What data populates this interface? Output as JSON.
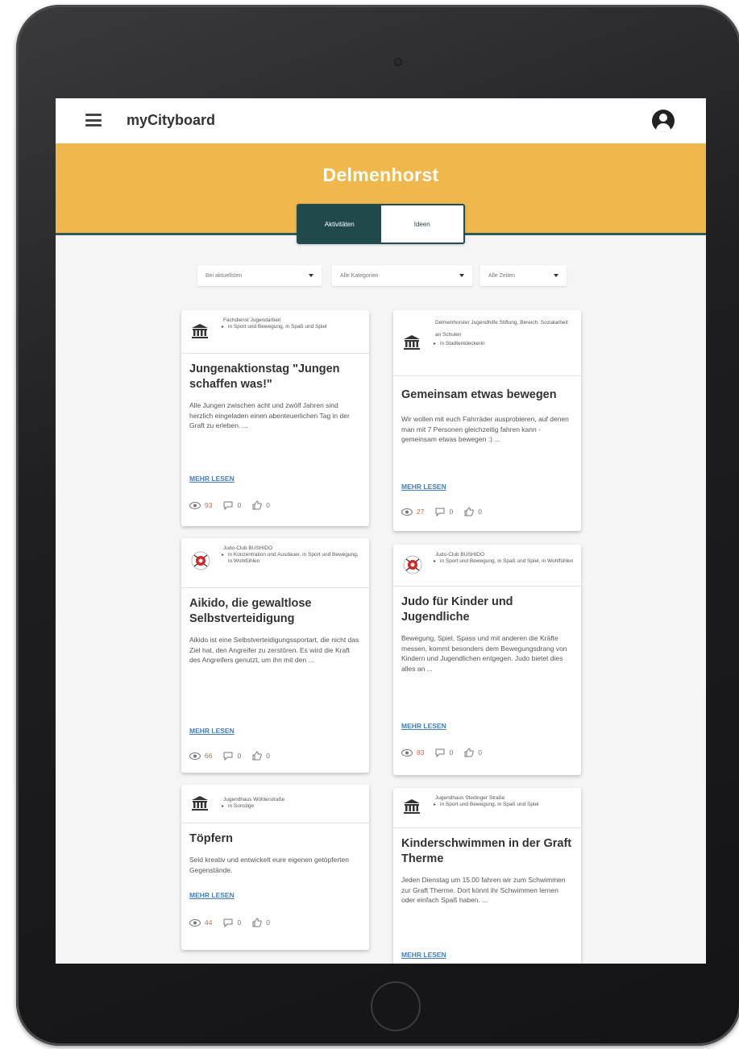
{
  "app": {
    "title": "myCityboard"
  },
  "banner": {
    "city": "Delmenhorst",
    "color": "#f0b84c"
  },
  "tabs": [
    {
      "label": "Aktivitäten",
      "active": true
    },
    {
      "label": "Ideen",
      "active": false
    }
  ],
  "filters": [
    {
      "value": "Bei aktuellsten"
    },
    {
      "value": "Alle Kategorien"
    },
    {
      "value": "Alle Zeiten"
    }
  ],
  "cards": [
    {
      "org": "Fachdienst Jugendarbeit",
      "category": "in Sport und Bewegung, in Spaß und Spiel",
      "title": "Jungenaktionstag \"Jungen schaffen was!\"",
      "text": "Alle Jungen zwischen acht und zwölf Jahren sind herzlich eingeladen einen abenteuerlichen Tag in der Graft zu erleben. ...",
      "read_more": "MEHR LESEN",
      "views": "93",
      "comments": "0",
      "likes": "0"
    },
    {
      "org": "Delmenhorster Jugendhilfe Stiftung, Bereich: Sozialarbeit an Schulen",
      "category": "in Stadtentdeckerin",
      "title": "Gemeinsam etwas bewegen",
      "text": "Wir wollen mit euch Fahrräder ausprobieren, auf denen man mit 7 Personen gleichzeitig fahren kann - gemeinsam etwas bewegen :) ...",
      "read_more": "MEHR LESEN",
      "views": "27",
      "comments": "0",
      "likes": "0"
    },
    {
      "org": "Judo-Club BUSHIDO",
      "category": "in Konzentration und Ausdauer, in Sport und Bewegung, in Wohlfühlen",
      "title": "Aikido, die gewaltlose Selbstverteidigung",
      "text": "Aikido ist eine Selbstverteidigungssportart, die nicht das Ziel hat, den Angreifer zu zerstören. Es wird die Kraft des Angreifers genutzt, um ihn mit den ...",
      "read_more": "MEHR LESEN",
      "views": "66",
      "comments": "0",
      "likes": "0"
    },
    {
      "org": "Judo-Club BUSHIDO",
      "category": "in Sport und Bewegung, in Spaß und Spiel, in Wohlfühlen",
      "title": "Judo für Kinder und Jugendliche",
      "text": "Bewegung, Spiel, Spass und mit anderen die Kräfte messen, kommt besonders dem Bewegungsdrang von Kindern und Jugendlichen entgegen. Judo bietet dies alles an ...",
      "read_more": "MEHR LESEN",
      "views": "83",
      "comments": "0",
      "likes": "0"
    },
    {
      "org": "Jugendhaus Wöhlerstraße",
      "category": "in Sonstige",
      "title": "Töpfern",
      "text": "Seid kreativ und entwickelt eure eigenen getöpferten Gegenstände.",
      "read_more": "MEHR LESEN",
      "views": "44",
      "comments": "0",
      "likes": "0"
    },
    {
      "org": "Jugendhaus Stedinger Straße",
      "category": "in Sport und Bewegung, in Spaß und Spiel",
      "title": "Kinderschwimmen in der Graft Therme",
      "text": "Jeden Dienstag um 15.00 fahren wir zum Schwimmen zur Graft Therme. Dort könnt ihr Schwimmen lernen oder einfach Spaß haben. ...",
      "read_more": "MEHR LESEN",
      "views": "",
      "comments": "",
      "likes": ""
    }
  ],
  "icons": {
    "menu": "hamburger-menu-icon",
    "account": "account-circle-icon",
    "institution": "institution-icon",
    "club_logo": "club-logo-icon",
    "views": "eye-icon",
    "comments": "comment-icon",
    "likes": "thumbs-up-icon"
  }
}
